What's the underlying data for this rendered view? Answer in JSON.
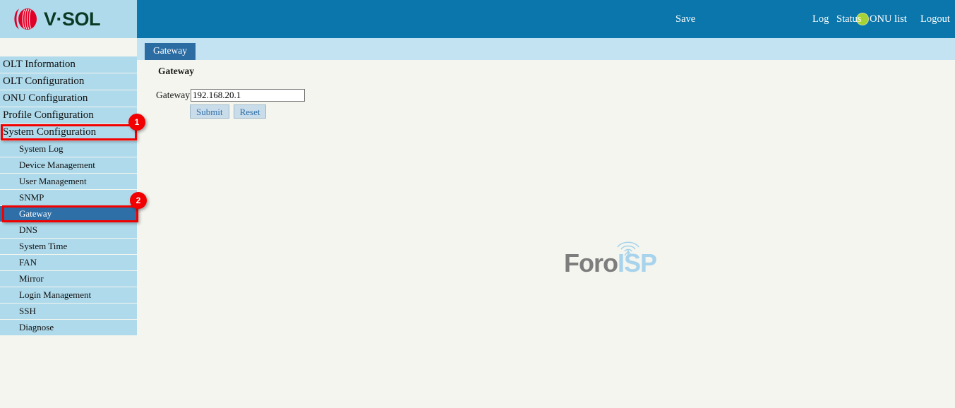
{
  "brand": {
    "name": "V·SOL",
    "logo_icon": "vsol-sphere-logo",
    "logo_color": "#D9002B",
    "text_color": "#0A3A24"
  },
  "header": {
    "background": "#0A76AC",
    "save_label": "Save",
    "indicator_icon": "status-dot-green",
    "indicator_color": "#A7D236",
    "links": {
      "log": "Log",
      "status": "Status",
      "onu_list": "ONU list",
      "logout": "Logout"
    }
  },
  "tabs": {
    "strip_background": "#C3E2F2",
    "active_label": "Gateway",
    "active_color": "#2B6CA3"
  },
  "sidebar": {
    "item_background": "#AFDAEB",
    "active_background": "#2E6FA7",
    "top_items": [
      {
        "label": "OLT Information"
      },
      {
        "label": "OLT Configuration"
      },
      {
        "label": "ONU Configuration"
      },
      {
        "label": "Profile Configuration"
      },
      {
        "label": "System Configuration"
      }
    ],
    "sub_items": [
      {
        "label": "System Log"
      },
      {
        "label": "Device Management"
      },
      {
        "label": "User Management"
      },
      {
        "label": "SNMP"
      },
      {
        "label": "Gateway"
      },
      {
        "label": "DNS"
      },
      {
        "label": "System Time"
      },
      {
        "label": "FAN"
      },
      {
        "label": "Mirror"
      },
      {
        "label": "Login Management"
      },
      {
        "label": "SSH"
      },
      {
        "label": "Diagnose"
      }
    ]
  },
  "content": {
    "title": "Gateway",
    "field_label": "Gateway",
    "field_value": "192.168.20.1",
    "field_placeholder": "",
    "submit_label": "Submit",
    "reset_label": "Reset"
  },
  "watermark": {
    "part1": "Foro",
    "part2": "ISP",
    "icon": "signal-tower-icon",
    "part1_color": "#7D7D7D",
    "part2_color": "#A8D3EC"
  },
  "annotations": {
    "badge_color": "#F20000",
    "steps": [
      {
        "number": "1",
        "target": "System Configuration"
      },
      {
        "number": "2",
        "target": "Gateway"
      }
    ]
  }
}
